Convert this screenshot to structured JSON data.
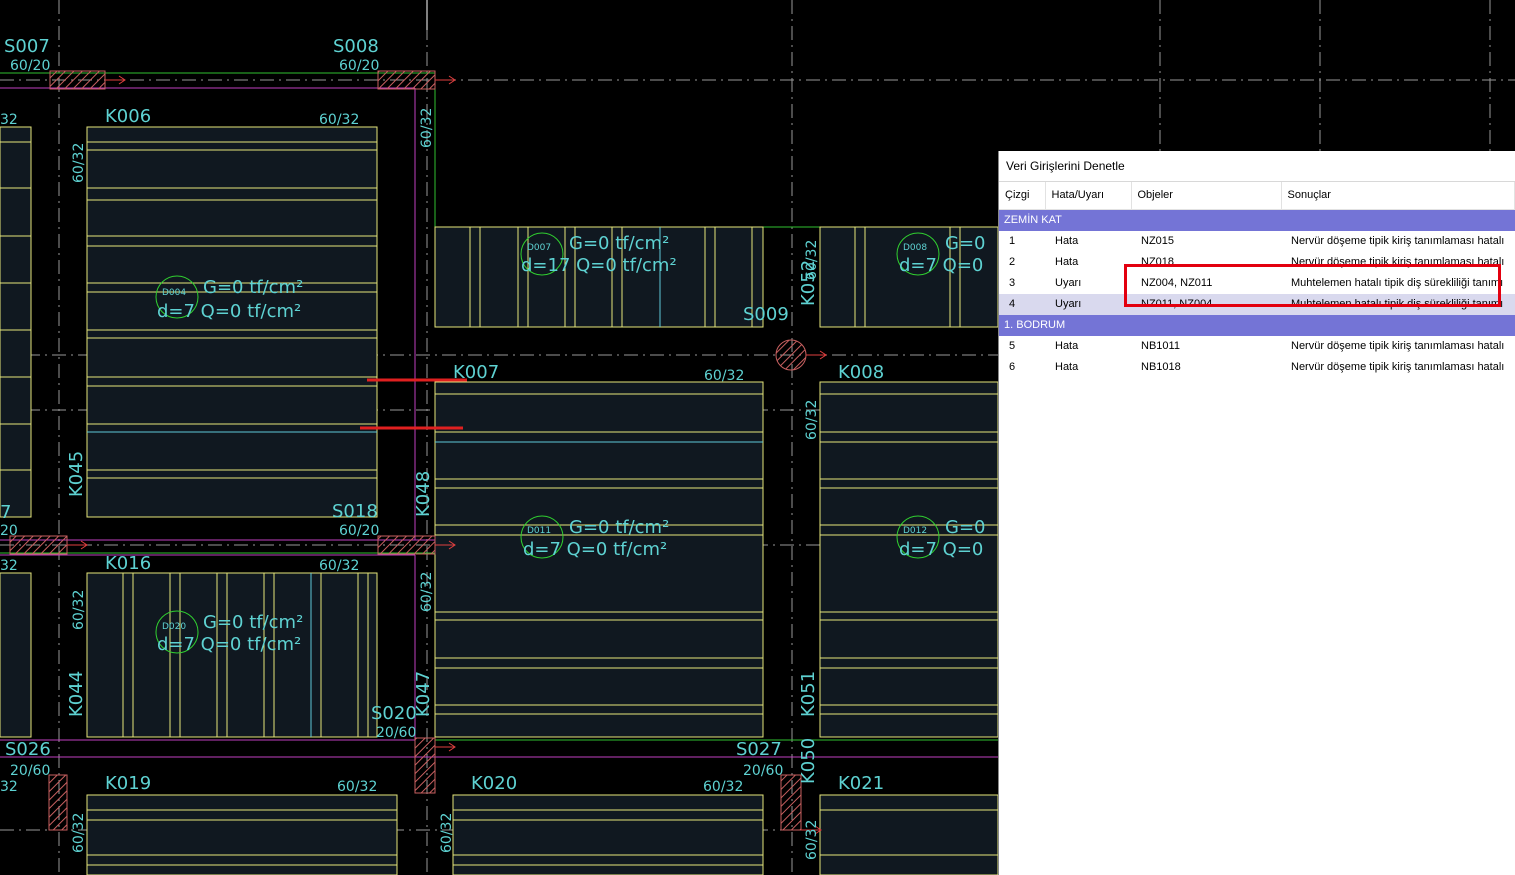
{
  "drawing": {
    "columns": [
      {
        "id": "s007",
        "label": "S007"
      },
      {
        "id": "s008",
        "label": "S008"
      },
      {
        "id": "s009",
        "label": "S009"
      },
      {
        "id": "s018",
        "label": "S018"
      },
      {
        "id": "s020",
        "label": "S020"
      },
      {
        "id": "s026",
        "label": "S026"
      },
      {
        "id": "s027",
        "label": "S027"
      }
    ],
    "beams": [
      {
        "id": "k006",
        "label": "K006"
      },
      {
        "id": "k007",
        "label": "K007"
      },
      {
        "id": "k008",
        "label": "K008"
      },
      {
        "id": "k016",
        "label": "K016"
      },
      {
        "id": "k019",
        "label": "K019"
      },
      {
        "id": "k020",
        "label": "K020"
      },
      {
        "id": "k021",
        "label": "K021"
      },
      {
        "id": "k044",
        "label": "K044"
      },
      {
        "id": "k045",
        "label": "K045"
      },
      {
        "id": "k047",
        "label": "K047"
      },
      {
        "id": "k048",
        "label": "K048"
      },
      {
        "id": "k050",
        "label": "K050"
      },
      {
        "id": "k051",
        "label": "K051"
      },
      {
        "id": "k052",
        "label": "K052"
      }
    ],
    "dims": {
      "d6020": "60/20",
      "d6032": "60/32",
      "d2060": "20/60"
    },
    "slabs": [
      {
        "id": "d004",
        "tag": "D004",
        "load1": "G=0 tf/cm²",
        "load2": "d=7 Q=0 tf/cm²"
      },
      {
        "id": "d007",
        "tag": "D007",
        "load1": "G=0 tf/cm²",
        "load2": "d=17 Q=0 tf/cm²"
      },
      {
        "id": "d008",
        "tag": "D008",
        "load1": "G=0",
        "load2": "d=7 Q=0"
      },
      {
        "id": "d011",
        "tag": "D011",
        "load1": "G=0 tf/cm²",
        "load2": "d=7 Q=0 tf/cm²"
      },
      {
        "id": "d012",
        "tag": "D012",
        "load1": "G=0",
        "load2": "d=7 Q=0"
      },
      {
        "id": "d020",
        "tag": "D020",
        "load1": "G=0 tf/cm²",
        "load2": "d=7 Q=0 tf/cm²"
      }
    ],
    "edge_labels": {
      "left_a": "32",
      "left_b": "7",
      "left_c": "20",
      "left_d": "32",
      "left_e": "32"
    }
  },
  "panel": {
    "title": "Veri Girişlerini Denetle",
    "columns": [
      "Çizgi",
      "Hata/Uyarı",
      "Objeler",
      "Sonuçlar"
    ],
    "groups": [
      {
        "name": "ZEMİN KAT",
        "rows": [
          {
            "line": "1",
            "type": "Hata",
            "objects": "NZ015",
            "result": "Nervür döşeme tipik kiriş tanımlaması hatalı"
          },
          {
            "line": "2",
            "type": "Hata",
            "objects": "NZ018",
            "result": "Nervür döşeme tipik kiriş tanımlaması hatalı"
          },
          {
            "line": "3",
            "type": "Uyarı",
            "objects": "NZ004, NZ011",
            "result": "Muhtelemen hatalı tipik diş sürekliliği tanımı"
          },
          {
            "line": "4",
            "type": "Uyarı",
            "objects": "NZ011, NZ004",
            "result": "Muhtelemen hatalı tipik diş sürekliliği tanımı"
          }
        ]
      },
      {
        "name": "1. BODRUM",
        "rows": [
          {
            "line": "5",
            "type": "Hata",
            "objects": "NB1011",
            "result": "Nervür döşeme tipik kiriş tanımlaması hatalı"
          },
          {
            "line": "6",
            "type": "Hata",
            "objects": "NB1018",
            "result": "Nervür döşeme tipik kiriş tanımlaması hatalı"
          }
        ]
      }
    ],
    "selected_line": "4"
  },
  "colors": {
    "background": "#000000",
    "beam_text": "#5ed2d2",
    "slab_line": "#e6e67a",
    "beam_edge": "#c040c0",
    "column_fill": "#c85050",
    "axis": "#ffffff",
    "highlight": "#e3000f",
    "group_row": "#7474d6"
  }
}
